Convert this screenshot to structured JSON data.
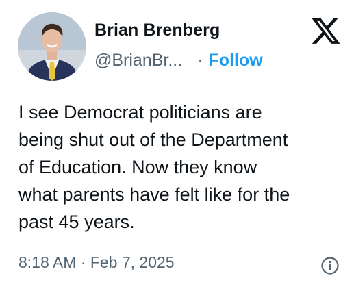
{
  "author": {
    "display_name": "Brian Brenberg",
    "handle": "@BrianBr...",
    "separator": "·",
    "follow_label": "Follow"
  },
  "brand": {
    "logo_icon": "x-logo-icon"
  },
  "tweet": {
    "lines": [
      "I see Democrat politicians are",
      "being shut out of the Department",
      "of Education. Now they know",
      "what parents have felt like for the",
      "past 45 years."
    ],
    "timestamp": "8:18 AM · Feb 7, 2025"
  },
  "icons": {
    "info": "info-icon"
  },
  "colors": {
    "accent": "#1d9bf0",
    "text_primary": "#0f1419",
    "text_secondary": "#536471",
    "background": "#ffffff"
  }
}
